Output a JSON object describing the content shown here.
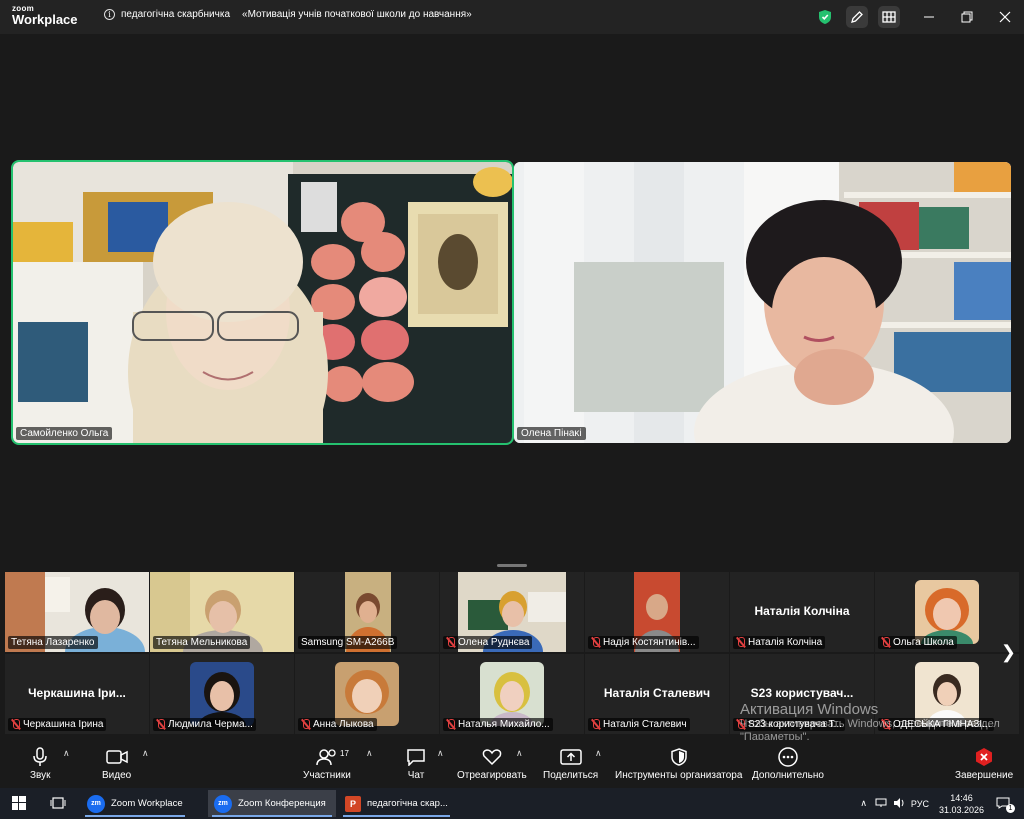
{
  "app": {
    "logo_small": "zoom",
    "logo_large": "Workplace"
  },
  "meeting": {
    "topic_part1": "педагогічна  скарбничка",
    "topic_part2": "«Мотивація учнів початкової  школи  до навчання»"
  },
  "main_speakers": [
    {
      "name": "Самойленко Ольга"
    },
    {
      "name": "Олена Пінаκі"
    }
  ],
  "gallery": [
    {
      "name": "Тетяна Лазаренко",
      "muted": false
    },
    {
      "name": "Тетяна Мельникова",
      "muted": false
    },
    {
      "name": "Samsung SM-A266B",
      "muted": false
    },
    {
      "name": "Олена Руднєва",
      "muted": true
    },
    {
      "name": "Надія Костянтинів...",
      "muted": true
    },
    {
      "name": "Наталія Колчіна",
      "big_name": "Наталія Колчіна",
      "muted": true
    },
    {
      "name": "Ольга Школа",
      "muted": true
    },
    {
      "name": "Черкашина Ірина",
      "big_name": "Черкашина Іри...",
      "muted": true
    },
    {
      "name": "Людмила Черма...",
      "muted": true
    },
    {
      "name": "Анна Лыкова",
      "muted": true
    },
    {
      "name": "Наталья Михайло...",
      "muted": true
    },
    {
      "name": "Наталія Сталевич",
      "big_name": "Наталія Сталевич",
      "muted": true
    },
    {
      "name": "S23 користувача Т...",
      "big_name": "S23  користувач...",
      "muted": true
    },
    {
      "name": "ОДЕСЬКА ГІМНАЗІ...",
      "muted": true
    }
  ],
  "watermark": {
    "title": "Активация Windows",
    "line": "Чтобы активировать Windows, перейдите в раздел \"Параметры\"."
  },
  "toolbar": {
    "audio": "Звук",
    "video": "Видео",
    "participants": "Участники",
    "participants_count": "17",
    "chat": "Чат",
    "react": "Отреагировать",
    "share": "Поделиться",
    "host_tools": "Инструменты организатора",
    "more": "Дополнительно",
    "end": "Завершение"
  },
  "taskbar": {
    "app1": "Zoom Workplace",
    "app2": "Zoom Конференция",
    "app3": "педагогічна скар...",
    "lang": "РУС",
    "time": "14:46",
    "date": "31.03.2026",
    "notif_count": "1"
  },
  "colors": {
    "active_border": "#25c16f",
    "mute": "#e24040",
    "shield": "#25c16f",
    "end": "#e02020"
  }
}
